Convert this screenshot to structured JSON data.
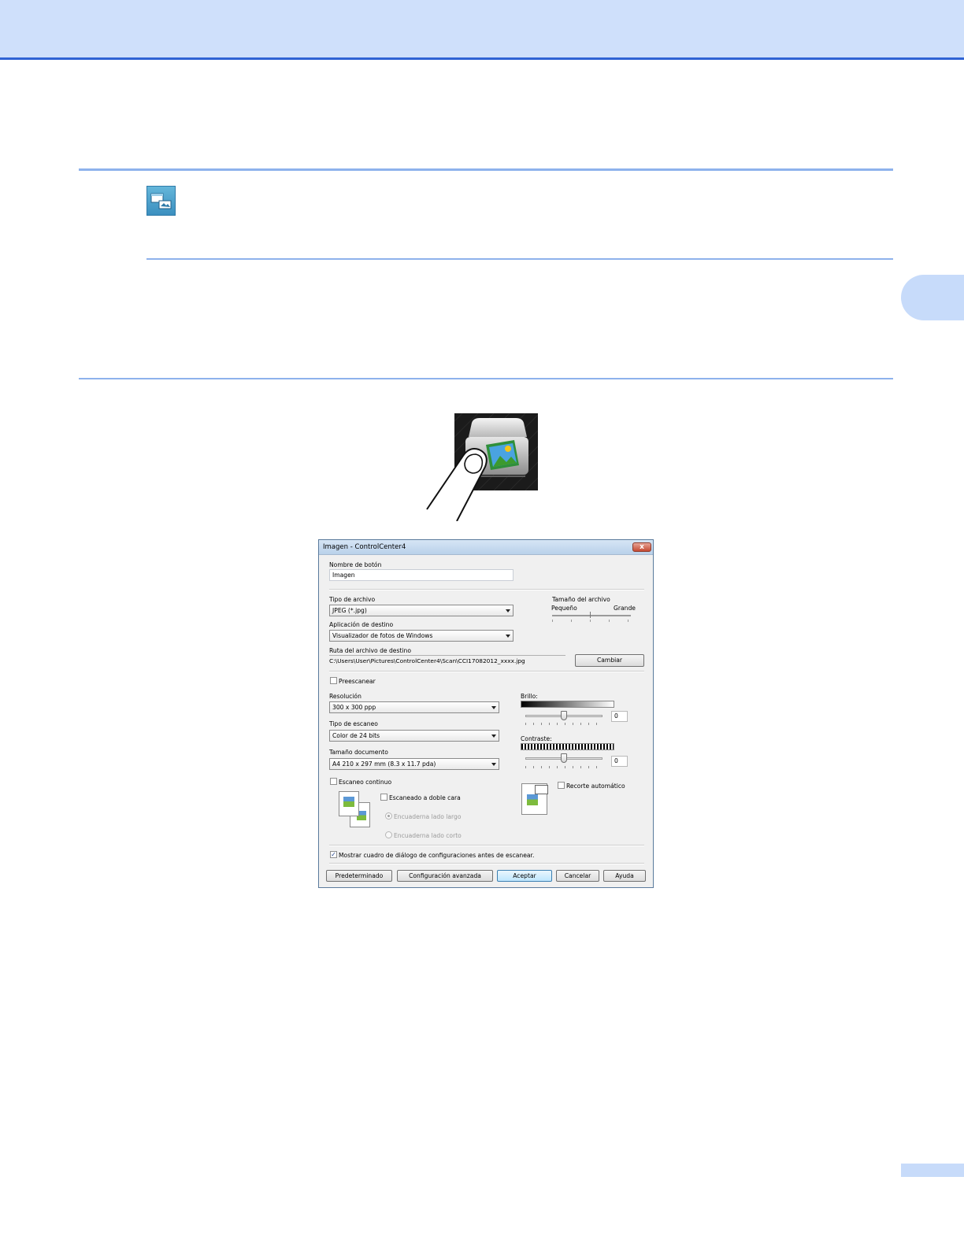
{
  "dialog": {
    "title": "Imagen - ControlCenter4",
    "close_glyph": "x",
    "button_name_label": "Nombre de botón",
    "button_name_value": "Imagen",
    "file_type_label": "Tipo de archivo",
    "file_type_value": "JPEG (*.jpg)",
    "file_size_label": "Tamaño del archivo",
    "file_size_small": "Pequeño",
    "file_size_large": "Grande",
    "file_size_level": 0.5,
    "target_app_label": "Aplicación de destino",
    "target_app_value": "Visualizador de fotos de Windows",
    "dest_path_label": "Ruta del archivo de destino",
    "dest_path_value": "C:\\Users\\User\\Pictures\\ControlCenter4\\Scan\\CCI17082012_xxxx.jpg",
    "change_button": "Cambiar",
    "prescan_label": "Preescanear",
    "prescan_checked": false,
    "resolution_label": "Resolución",
    "resolution_value": "300 x 300 ppp",
    "scan_type_label": "Tipo de escaneo",
    "scan_type_value": "Color de 24 bits",
    "doc_size_label": "Tamaño documento",
    "doc_size_value": "A4 210 x 297 mm (8.3 x 11.7 pda)",
    "brightness_label": "Brillo:",
    "brightness_value": "0",
    "contrast_label": "Contraste:",
    "contrast_value": "0",
    "continuous_label": "Escaneo continuo",
    "duplex_label": "Escaneado a doble cara",
    "long_edge_label": "Encuaderna lado largo",
    "short_edge_label": "Encuaderna lado corto",
    "autocrop_label": "Recorte automático",
    "show_dialog_label": "Mostrar cuadro de diálogo de configuraciones antes de escanear.",
    "show_dialog_checked": true,
    "check_glyph": "✓",
    "buttons": {
      "default": "Predeterminado",
      "advanced": "Configuración avanzada",
      "ok": "Aceptar",
      "cancel": "Cancelar",
      "help": "Ayuda"
    }
  },
  "icons": {
    "note": "note-icon",
    "scanner": "scanner-touch-icon"
  },
  "colors": {
    "header_band": "#cfe0fb",
    "header_line": "#2f63d4",
    "rule": "#8eb2ec"
  }
}
